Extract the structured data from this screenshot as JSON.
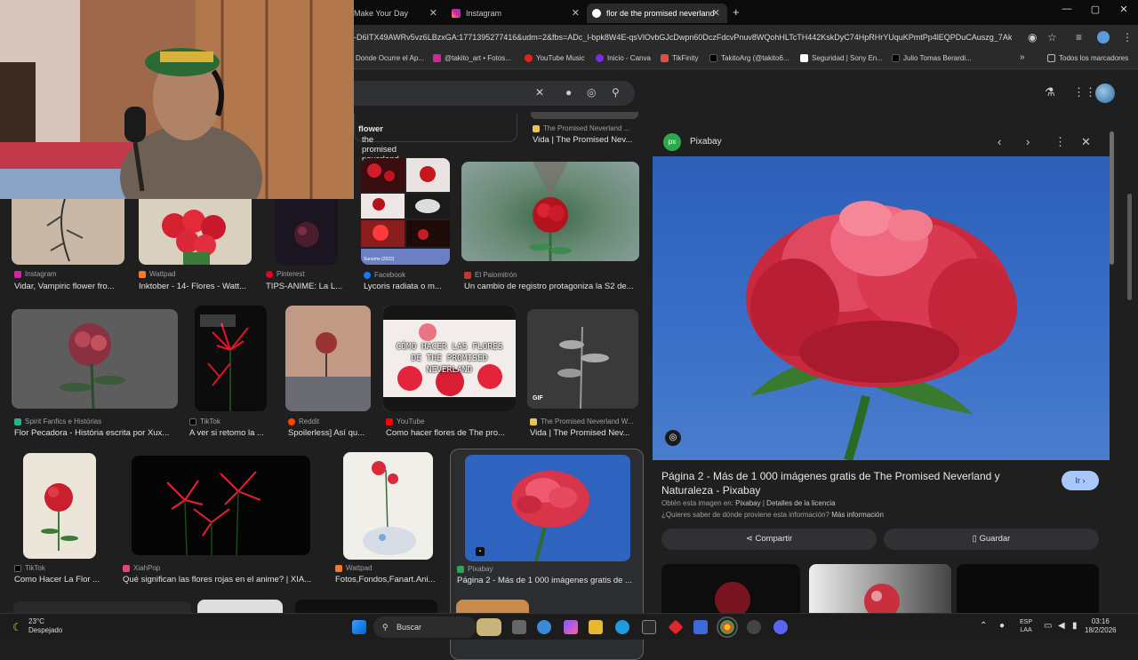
{
  "browser": {
    "tabs": [
      {
        "label": "Make Your Day"
      },
      {
        "label": "Instagram"
      },
      {
        "label": "flor de the promised neverland"
      }
    ],
    "new_tab": "+",
    "url": "-D6ITX49AWRv5vz6LBzxGA:1771395277416&udm=2&fbs=ADc_l-bpk8W4E-qsVlOvbGJcDwpn60DczFdcvPnuv8WQohHLTcTH442KskDyC74HpRHrYUquKPmtPp4lEQPDuCAuszg_7Akj...",
    "bookmarks": [
      "Donde Ocurre el Ap...",
      "@takito_art • Fotos...",
      "YouTube Music",
      "Inicio - Canva",
      "TikFinity",
      "TakitoArg (@takito6...",
      "Seguridad | Sony En...",
      "Julio Tomas Berardi...",
      "»",
      "Todos los marcadores"
    ]
  },
  "results": {
    "query_chip": "the promised neverland ",
    "query_chip_bold": "flower",
    "items": [
      {
        "source": "The Promised Neverland ...",
        "caption": "Vida | The Promised Nev..."
      },
      {
        "source": "Instagram",
        "caption": "Vidar, Vampiric flower fro..."
      },
      {
        "source": "Wattpad",
        "caption": "Inktober - 14- Flores - Watt..."
      },
      {
        "source": "Pinterest",
        "caption": "TIPS-ANIME: La L..."
      },
      {
        "source": "Facebook",
        "caption": "Lycoris radiata o m..."
      },
      {
        "source": "El Palomitrón",
        "caption": "Un cambio de registro protagoniza la S2 de..."
      },
      {
        "source": "Spirit Fanfics e Histórias",
        "caption": "Flor Pecadora - História escrita por Xux..."
      },
      {
        "source": "TikTok",
        "caption": "A ver si retomo la ..."
      },
      {
        "source": "Reddit",
        "caption": "Spoilerless] Así qu..."
      },
      {
        "source": "YouTube",
        "caption": "Como hacer flores de The pro..."
      },
      {
        "source": "The Promised Neverland W...",
        "caption": "Vida | The Promised Nev..."
      },
      {
        "source": "TikTok",
        "caption": "Como Hacer La Flor ..."
      },
      {
        "source": "XiahPop",
        "caption": "Qué significan las flores rojas en el anime? | XIA..."
      },
      {
        "source": "Wattpad",
        "caption": "Fotos,Fondos,Fanart.Ani..."
      },
      {
        "source": "Pixabay",
        "caption": "Página 2 - Más de 1 000 imágenes gratis de ..."
      }
    ],
    "youtube_thumb_text": "CÓMO HACER LAS FLORES DE THE PROMISED NEVERLAND",
    "gif_badge": "GIF",
    "collage_caption": "Sunume (2022)"
  },
  "panel": {
    "source": "Pixabay",
    "logo_text": "px",
    "title": "Página 2 - Más de 1 000 imágenes gratis de The Promised Neverland y Naturaleza - Pixabay",
    "go_button": "Ir ›",
    "meta_prefix": "Obtén esta imagen en: ",
    "meta_source": "Pixabay",
    "meta_sep": " | ",
    "meta_license": "Detalles de la licencia",
    "meta2_prefix": "¿Quieres saber de dónde proviene esta información? ",
    "meta2_link": "Más información",
    "share": "Compartir",
    "save": "Guardar"
  },
  "taskbar": {
    "temp": "23°C",
    "weather": "Despejado",
    "search": "Buscar",
    "lang1": "ESP",
    "lang2": "LAA",
    "time": "03:16",
    "date": "18/2/2026"
  },
  "colors": {
    "accent": "#a8c7fa",
    "pixabay": "#2ea84f"
  }
}
